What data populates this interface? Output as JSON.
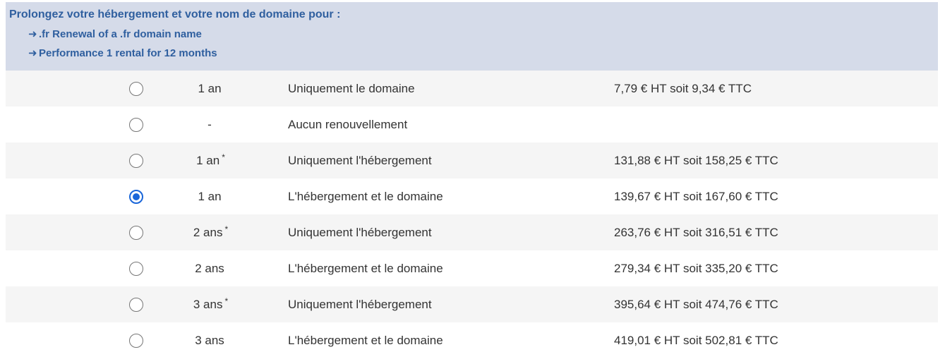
{
  "header": {
    "title": "Prolongez votre hébergement et votre nom de domaine pour :",
    "lines": [
      {
        "arrow": "➜",
        "text": ".fr Renewal of a .fr domain name"
      },
      {
        "arrow": "➜",
        "text": "Performance 1 rental for 12 months"
      }
    ]
  },
  "options": [
    {
      "duration": "1 an",
      "star": "",
      "description": "Uniquement le domaine",
      "price": "7,79 € HT soit 9,34 € TTC",
      "selected": false
    },
    {
      "duration": "-",
      "star": "",
      "description": "Aucun renouvellement",
      "price": "",
      "selected": false
    },
    {
      "duration": "1 an",
      "star": "*",
      "description": "Uniquement l'hébergement",
      "price": "131,88 € HT soit 158,25 € TTC",
      "selected": false
    },
    {
      "duration": "1 an",
      "star": "",
      "description": "L'hébergement et le domaine",
      "price": "139,67 € HT soit 167,60 € TTC",
      "selected": true
    },
    {
      "duration": "2 ans",
      "star": "*",
      "description": "Uniquement l'hébergement",
      "price": "263,76 € HT soit 316,51 € TTC",
      "selected": false
    },
    {
      "duration": "2 ans",
      "star": "",
      "description": "L'hébergement et le domaine",
      "price": "279,34 € HT soit 335,20 € TTC",
      "selected": false
    },
    {
      "duration": "3 ans",
      "star": "*",
      "description": "Uniquement l'hébergement",
      "price": "395,64 € HT soit 474,76 € TTC",
      "selected": false
    },
    {
      "duration": "3 ans",
      "star": "",
      "description": "L'hébergement et le domaine",
      "price": "419,01 € HT soit 502,81 € TTC",
      "selected": false
    }
  ],
  "colors": {
    "header_bg": "#d5dbe9",
    "header_text": "#2f5f9f",
    "row_alt_bg": "#f5f5f5",
    "radio_checked": "#1a66d9"
  }
}
